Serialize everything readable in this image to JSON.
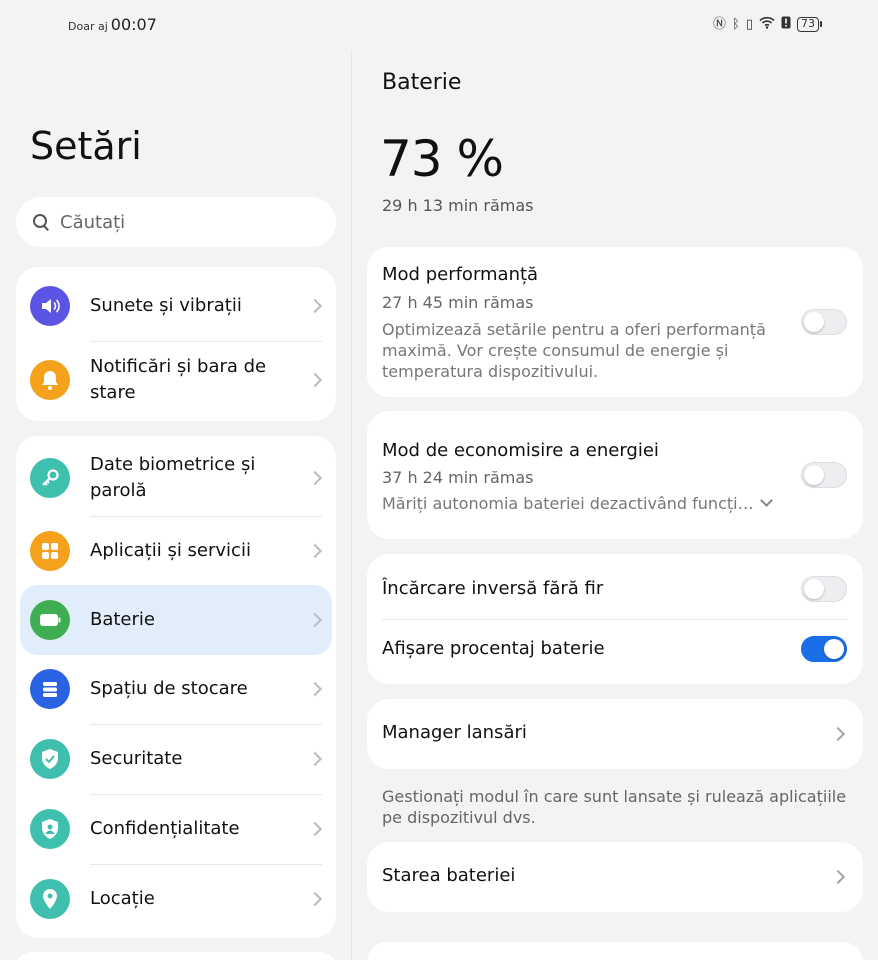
{
  "status_bar": {
    "carrier_text": "Doar aj",
    "time": "00:07",
    "battery_level": "73"
  },
  "sidebar": {
    "title": "Setări",
    "search_placeholder": "Căutați",
    "groups": [
      {
        "items": [
          {
            "label": "Sunete și vibrații",
            "icon": "speaker-icon",
            "color": "#5b55e6"
          },
          {
            "label": "Notificări și bara de stare",
            "icon": "bell-icon",
            "color": "#f5a11c"
          }
        ]
      },
      {
        "items": [
          {
            "label": "Date biometrice și parolă",
            "icon": "key-icon",
            "color": "#3fbfae"
          },
          {
            "label": "Aplicații și servicii",
            "icon": "apps-icon",
            "color": "#f5a11c"
          },
          {
            "label": "Baterie",
            "icon": "battery-icon",
            "color": "#3fae52",
            "active": true
          },
          {
            "label": "Spațiu de stocare",
            "icon": "storage-icon",
            "color": "#2a62e4"
          },
          {
            "label": "Securitate",
            "icon": "shield-check-icon",
            "color": "#3fbfae"
          },
          {
            "label": "Confidențialitate",
            "icon": "privacy-shield-icon",
            "color": "#3fbfae"
          },
          {
            "label": "Locație",
            "icon": "location-pin-icon",
            "color": "#3fbfae"
          }
        ]
      }
    ]
  },
  "main": {
    "header": "Baterie",
    "percent": "73 %",
    "remaining": "29 h 13 min rămas",
    "performance": {
      "title": "Mod performanță",
      "remaining": "27 h 45 min rămas",
      "description": "Optimizează setările pentru a oferi performanță maximă. Vor crește consumul de energie și temperatura dispozitivului.",
      "enabled": false
    },
    "power_saving": {
      "title": "Mod de economisire a energiei",
      "remaining": "37 h 24 min rămas",
      "description": "Măriți autonomia bateriei dezactivând funcți…",
      "enabled": false
    },
    "reverse_charging": {
      "label": "Încărcare inversă fără fir",
      "enabled": false
    },
    "show_percentage": {
      "label": "Afișare procentaj baterie",
      "enabled": true
    },
    "launch_manager": {
      "label": "Manager lansări",
      "footnote": "Gestionați modul în care sunt lansate și rulează aplicațiile pe dispozitivul dvs."
    },
    "battery_health": {
      "label": "Starea bateriei"
    }
  },
  "colors": {
    "accent": "#1a6ee8",
    "active_item_bg": "#e1edfb",
    "background": "#f1f3f5"
  }
}
